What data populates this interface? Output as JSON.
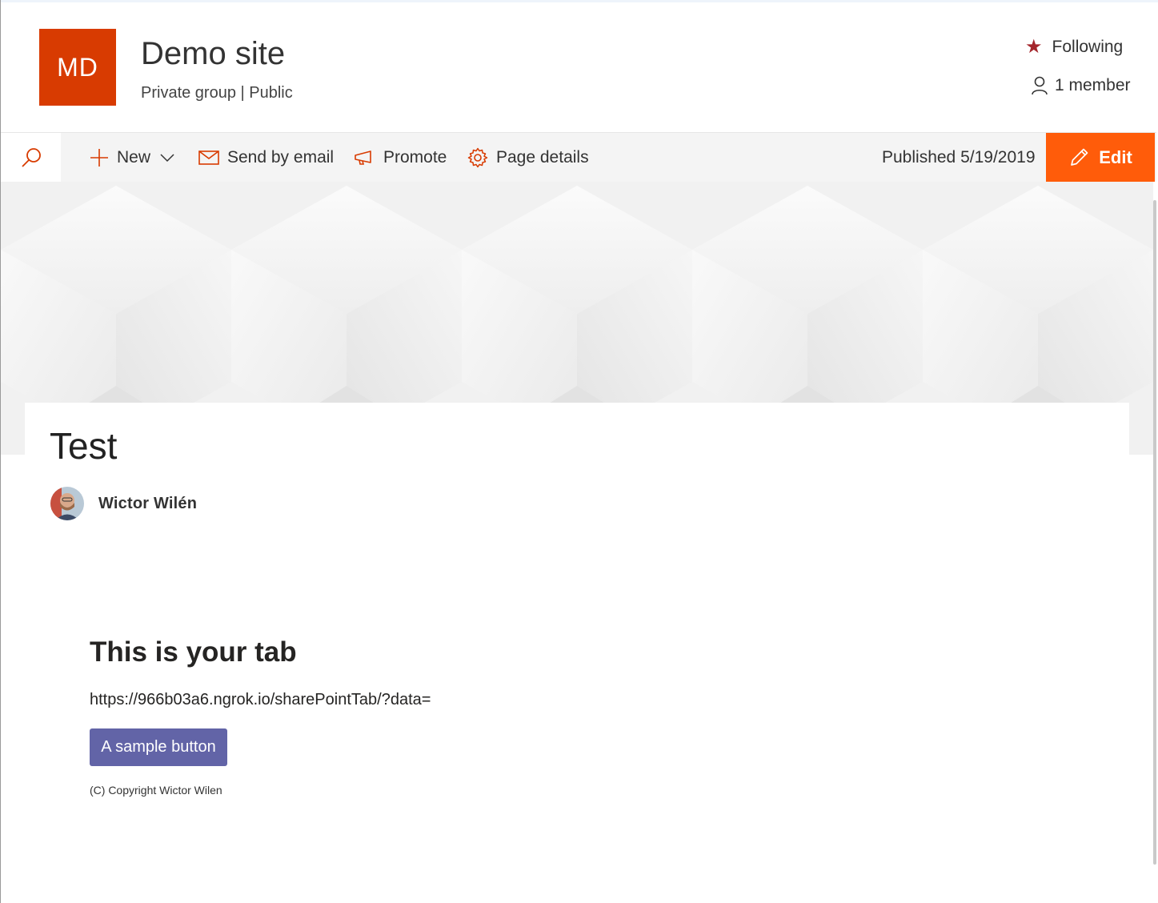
{
  "site": {
    "logo_initials": "MD",
    "title": "Demo site",
    "subtitle": "Private group | Public",
    "following_label": "Following",
    "members_label": "1 member"
  },
  "command_bar": {
    "new_label": "New",
    "send_email_label": "Send by email",
    "promote_label": "Promote",
    "page_details_label": "Page details",
    "published_label": "Published 5/19/2019",
    "edit_label": "Edit"
  },
  "page": {
    "title": "Test",
    "author": "Wictor Wilén"
  },
  "tab": {
    "heading": "This is your tab",
    "url": "https://966b03a6.ngrok.io/sharePointTab/?data=",
    "button_label": "A sample button",
    "copyright": "(C) Copyright Wictor Wilen"
  },
  "colors": {
    "logo": "#d83b01",
    "accent": "#ff5c0a",
    "teams_purple": "#6264a7",
    "star": "#a4262c"
  }
}
